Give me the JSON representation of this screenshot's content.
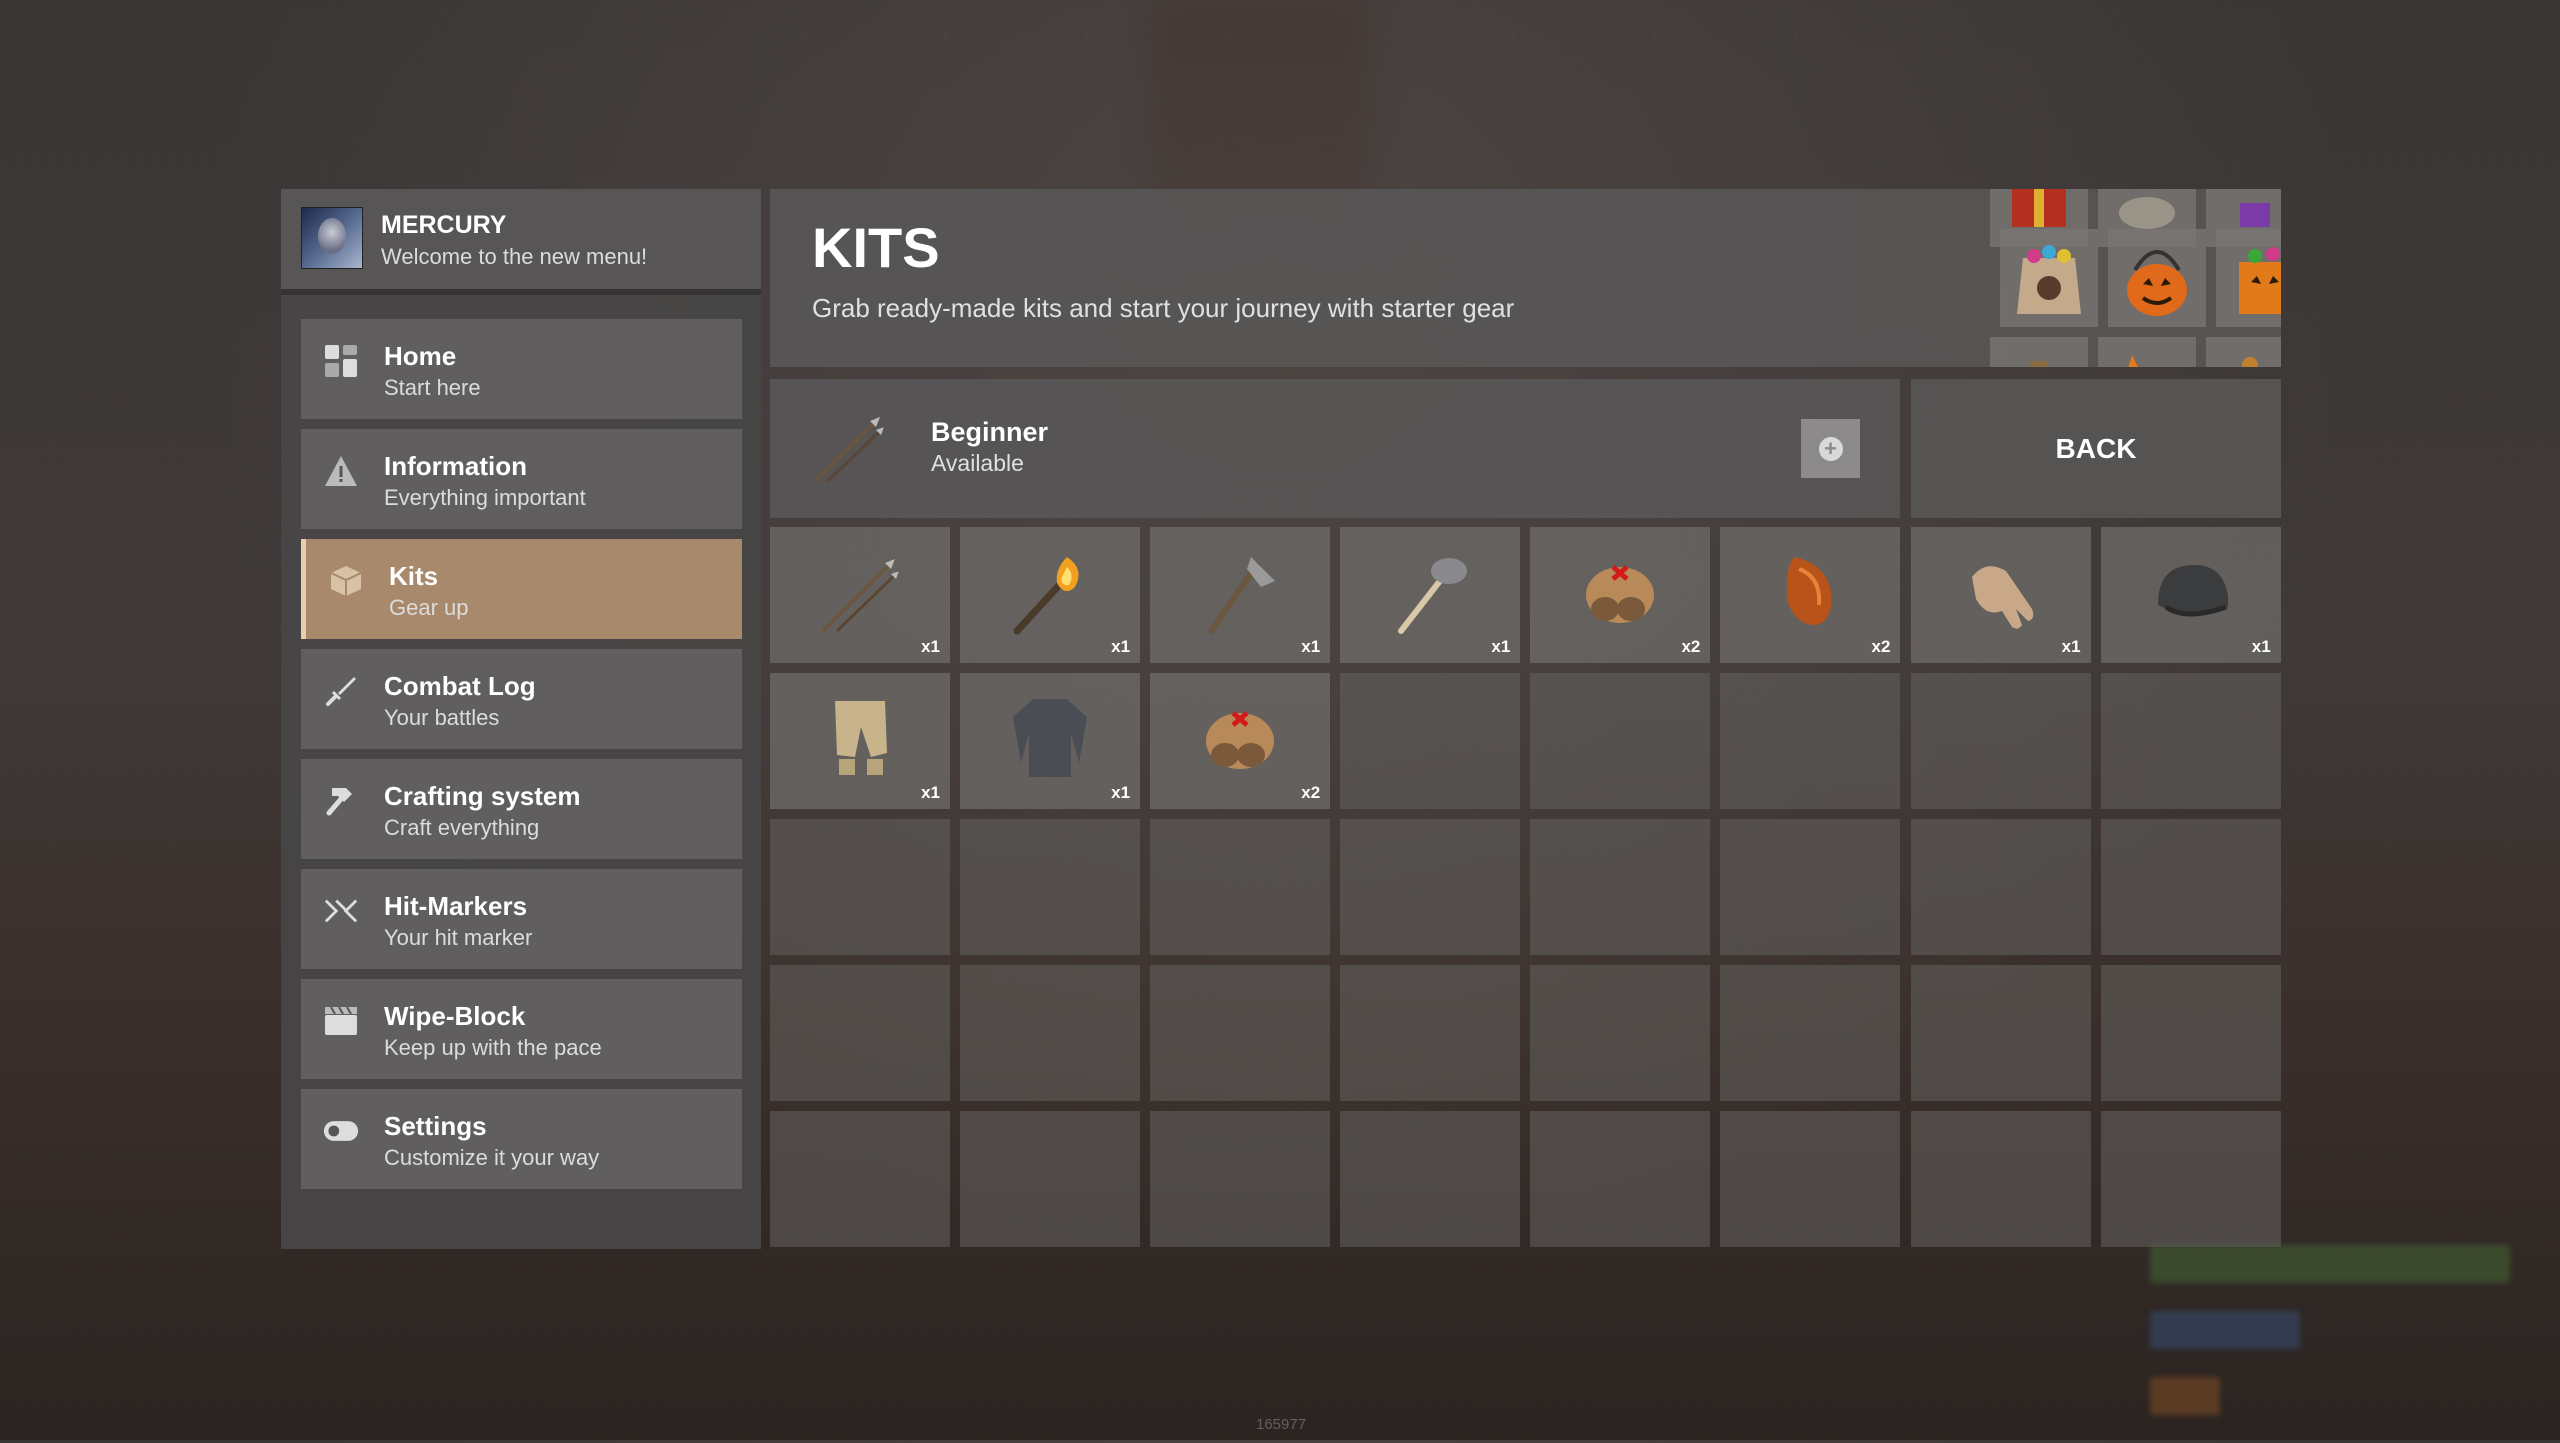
{
  "profile": {
    "name": "MERCURY",
    "subtitle": "Welcome to the new menu!",
    "avatar_icon": "avatar-portrait"
  },
  "nav": [
    {
      "label": "Home",
      "sub": "Start here",
      "icon": "home-grid-icon",
      "active": false
    },
    {
      "label": "Information",
      "sub": "Everything important",
      "icon": "warning-icon",
      "active": false
    },
    {
      "label": "Kits",
      "sub": "Gear up",
      "icon": "box-icon",
      "active": true
    },
    {
      "label": "Combat Log",
      "sub": "Your battles",
      "icon": "sword-icon",
      "active": false
    },
    {
      "label": "Crafting system",
      "sub": "Craft everything",
      "icon": "hammer-icon",
      "active": false
    },
    {
      "label": "Hit-Markers",
      "sub": "Your hit marker",
      "icon": "crosshair-icon",
      "active": false
    },
    {
      "label": "Wipe-Block",
      "sub": "Keep up with the pace",
      "icon": "clapperboard-icon",
      "active": false
    },
    {
      "label": "Settings",
      "sub": "Customize it your way",
      "icon": "toggle-icon",
      "active": false
    }
  ],
  "header": {
    "title": "KITS",
    "subtitle": "Grab ready-made kits and start your journey with starter gear"
  },
  "kit": {
    "name": "Beginner",
    "status": "Available",
    "icon": "spear-icon",
    "add_icon": "plus-icon"
  },
  "back_label": "BACK",
  "items": [
    {
      "icon": "spear-icon",
      "qty": "x1"
    },
    {
      "icon": "torch-icon",
      "qty": "x1"
    },
    {
      "icon": "hatchet-icon",
      "qty": "x1"
    },
    {
      "icon": "rock-pickaxe-icon",
      "qty": "x1"
    },
    {
      "icon": "bandage-roll-icon",
      "qty": "x2"
    },
    {
      "icon": "cooked-meat-icon",
      "qty": "x2"
    },
    {
      "icon": "glove-icon",
      "qty": "x1"
    },
    {
      "icon": "cap-icon",
      "qty": "x1"
    },
    {
      "icon": "pants-icon",
      "qty": "x1"
    },
    {
      "icon": "shirt-icon",
      "qty": "x1"
    },
    {
      "icon": "bandage-roll-icon",
      "qty": "x2"
    }
  ],
  "empty_slot_count": 29,
  "footer_id": "165977",
  "colors": {
    "accent": "#a8896b",
    "accent_border": "#e8cfa9",
    "panel": "#484646"
  }
}
